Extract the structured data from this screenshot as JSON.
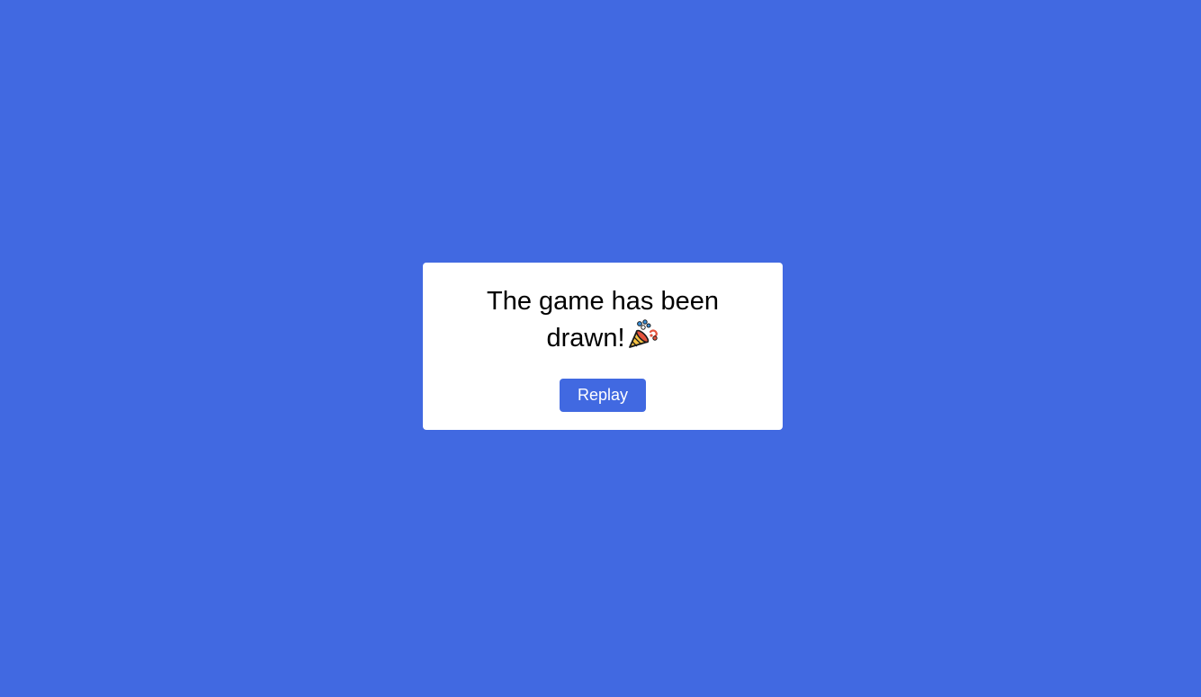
{
  "modal": {
    "message": "The game has been drawn!",
    "icon": "party-popper-icon",
    "replay_label": "Replay"
  },
  "colors": {
    "background": "#4169e1",
    "modal": "#ffffff",
    "button": "#4169e1",
    "button_text": "#ffffff",
    "text": "#000000"
  }
}
